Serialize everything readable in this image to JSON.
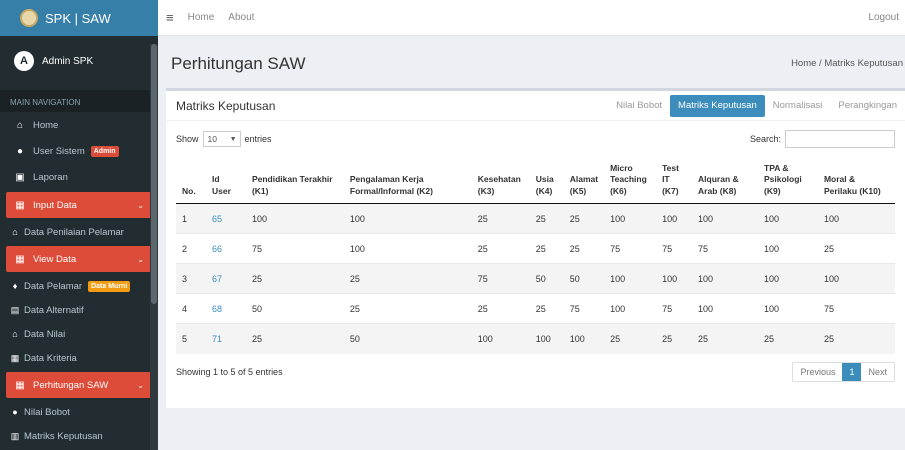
{
  "brand": {
    "title": "SPK | SAW"
  },
  "user": {
    "name": "Admin SPK",
    "avatar_letter": "A"
  },
  "sidebar": {
    "header": "MAIN NAVIGATION",
    "items": [
      {
        "label": "Home",
        "icon": "home-icon"
      },
      {
        "label": "User Sistem",
        "icon": "user-icon",
        "badge": "Admin"
      },
      {
        "label": "Laporan",
        "icon": "image-icon"
      },
      {
        "label": "Input Data",
        "icon": "edit-icon"
      },
      {
        "label": "Data Penilaian Pelamar",
        "icon": "bank-icon"
      },
      {
        "label": "View Data",
        "icon": "table-icon"
      },
      {
        "label": "Data Pelamar",
        "icon": "male-icon",
        "badge": "Data Murni"
      },
      {
        "label": "Data Alternatif",
        "icon": "list-icon"
      },
      {
        "label": "Data Nilai",
        "icon": "bank-icon"
      },
      {
        "label": "Data Kriteria",
        "icon": "calculator-icon"
      },
      {
        "label": "Perhitungan SAW",
        "icon": "calculator-icon"
      },
      {
        "label": "Nilai Bobot",
        "icon": "user-icon"
      },
      {
        "label": "Matriks Keputusan",
        "icon": "bar-chart-icon"
      }
    ]
  },
  "topbar": {
    "home": "Home",
    "about": "About",
    "logout": "Logout"
  },
  "page": {
    "title": "Perhitungan SAW",
    "breadcrumb": "Home / Matriks Keputusan"
  },
  "box": {
    "title": "Matriks Keputusan",
    "tabs": [
      "Nilai Bobot",
      "Matriks Keputusan",
      "Normalisasi",
      "Perangkingan"
    ],
    "show": "Show",
    "entries_value": "10",
    "entries": "entries",
    "search": "Search:",
    "info": "Showing 1 to 5 of 5 entries",
    "prev": "Previous",
    "page": "1",
    "next": "Next"
  },
  "table": {
    "headers": [
      "No.",
      "Id User",
      "Pendidikan Terakhir (K1)",
      "Pengalaman Kerja Formal/Informal (K2)",
      "Kesehatan (K3)",
      "Usia (K4)",
      "Alamat (K5)",
      "Micro Teaching (K6)",
      "Test IT (K7)",
      "Alquran & Arab (K8)",
      "TPA & Psikologi (K9)",
      "Moral & Perilaku (K10)"
    ],
    "rows": [
      [
        "1",
        "65",
        "100",
        "100",
        "25",
        "25",
        "25",
        "100",
        "100",
        "100",
        "100",
        "100"
      ],
      [
        "2",
        "66",
        "75",
        "100",
        "25",
        "25",
        "25",
        "75",
        "75",
        "75",
        "100",
        "25"
      ],
      [
        "3",
        "67",
        "25",
        "25",
        "75",
        "50",
        "50",
        "100",
        "100",
        "100",
        "100",
        "100"
      ],
      [
        "4",
        "68",
        "50",
        "25",
        "25",
        "25",
        "75",
        "100",
        "75",
        "100",
        "100",
        "75"
      ],
      [
        "5",
        "71",
        "25",
        "50",
        "100",
        "100",
        "100",
        "25",
        "25",
        "25",
        "25",
        "25"
      ]
    ]
  }
}
